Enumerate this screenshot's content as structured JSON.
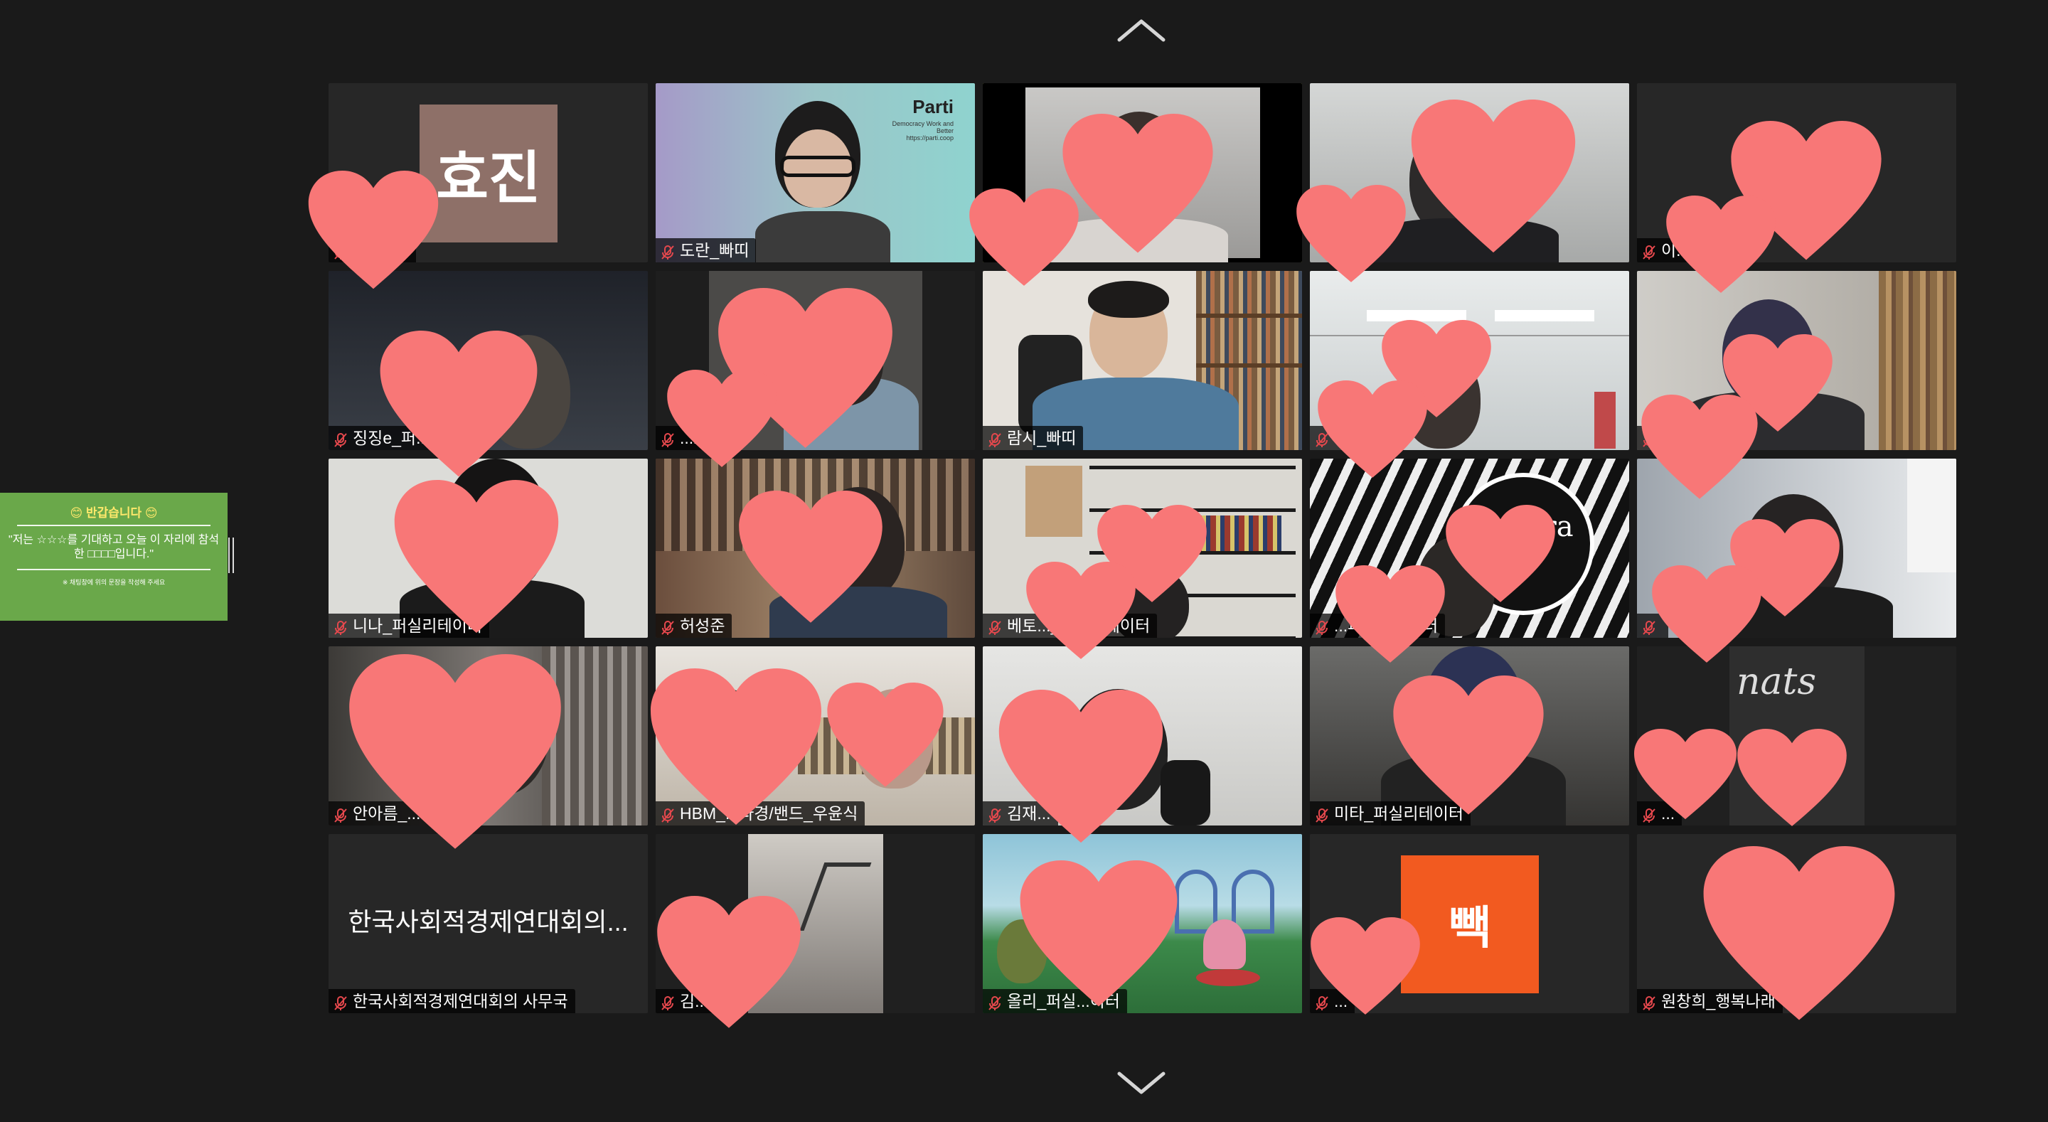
{
  "navigation": {
    "up_icon": "chevron-up-icon",
    "down_icon": "chevron-down-icon"
  },
  "side_panel": {
    "title": "😊 반갑습니다 😊",
    "body": "\"저는 ☆☆☆를 기대하고 오늘 이 자리에 참석한 □□□□입니다.\"",
    "footer": "※ 채팅창에 위의 문장을 작성해 주세요"
  },
  "colors": {
    "background": "#1a1a1a",
    "tile": "#272727",
    "active_speaker_border": "#d9ea7c",
    "heart": "#f87777",
    "side_panel": "#6aa84a"
  },
  "participants": [
    {
      "name": "효진(세)",
      "avatar_text": "효진",
      "video": false,
      "muted": true
    },
    {
      "name": "도란_빠띠",
      "video": true,
      "muted": true,
      "background_text": "Parti",
      "background_subtext": "Democracy Work and Better\nhttps://parti.coop"
    },
    {
      "name": "",
      "video": true,
      "muted": false,
      "active_speaker": true
    },
    {
      "name": "",
      "video": true,
      "muted": true
    },
    {
      "name": "이...",
      "center_text": "이",
      "video": false,
      "muted": true
    },
    {
      "name": "징징e_퍼...",
      "video": true,
      "muted": true
    },
    {
      "name": "...bo",
      "video": true,
      "muted": true
    },
    {
      "name": "람시_빠띠",
      "video": true,
      "muted": true
    },
    {
      "name": "...주",
      "video": true,
      "muted": true
    },
    {
      "name": "",
      "video": true,
      "muted": true
    },
    {
      "name": "니나_퍼실리테이터",
      "video": true,
      "muted": true
    },
    {
      "name": "허성준",
      "video": true,
      "muted": true
    },
    {
      "name": "베토..._퍼실리테이터",
      "video": true,
      "muted": true
    },
    {
      "name": "...퍼실리테이터",
      "video": true,
      "muted": true,
      "background_text": "is a ra"
    },
    {
      "name": "",
      "video": true,
      "muted": true
    },
    {
      "name": "안아름_...S",
      "video": true,
      "muted": true
    },
    {
      "name": "HBM_...다경/밴드_우윤식",
      "video": true,
      "muted": true
    },
    {
      "name": "김재...",
      "video": true,
      "muted": false
    },
    {
      "name": "미타_퍼실리테이터",
      "video": true,
      "muted": true
    },
    {
      "name": "...",
      "video": true,
      "muted": true,
      "background_text": "nats"
    },
    {
      "name": "한국사회적경제연대회의 사무국",
      "center_text": "한국사회적경제연대회의...",
      "video": false,
      "muted": true
    },
    {
      "name": "김...",
      "video": true,
      "muted": true
    },
    {
      "name": "올리_퍼실...이터",
      "video": true,
      "muted": true
    },
    {
      "name": "...",
      "avatar_text": "빽",
      "video": false,
      "muted": true
    },
    {
      "name": "원창희_행복나래",
      "center_text": "원...",
      "video": false,
      "muted": true
    }
  ]
}
